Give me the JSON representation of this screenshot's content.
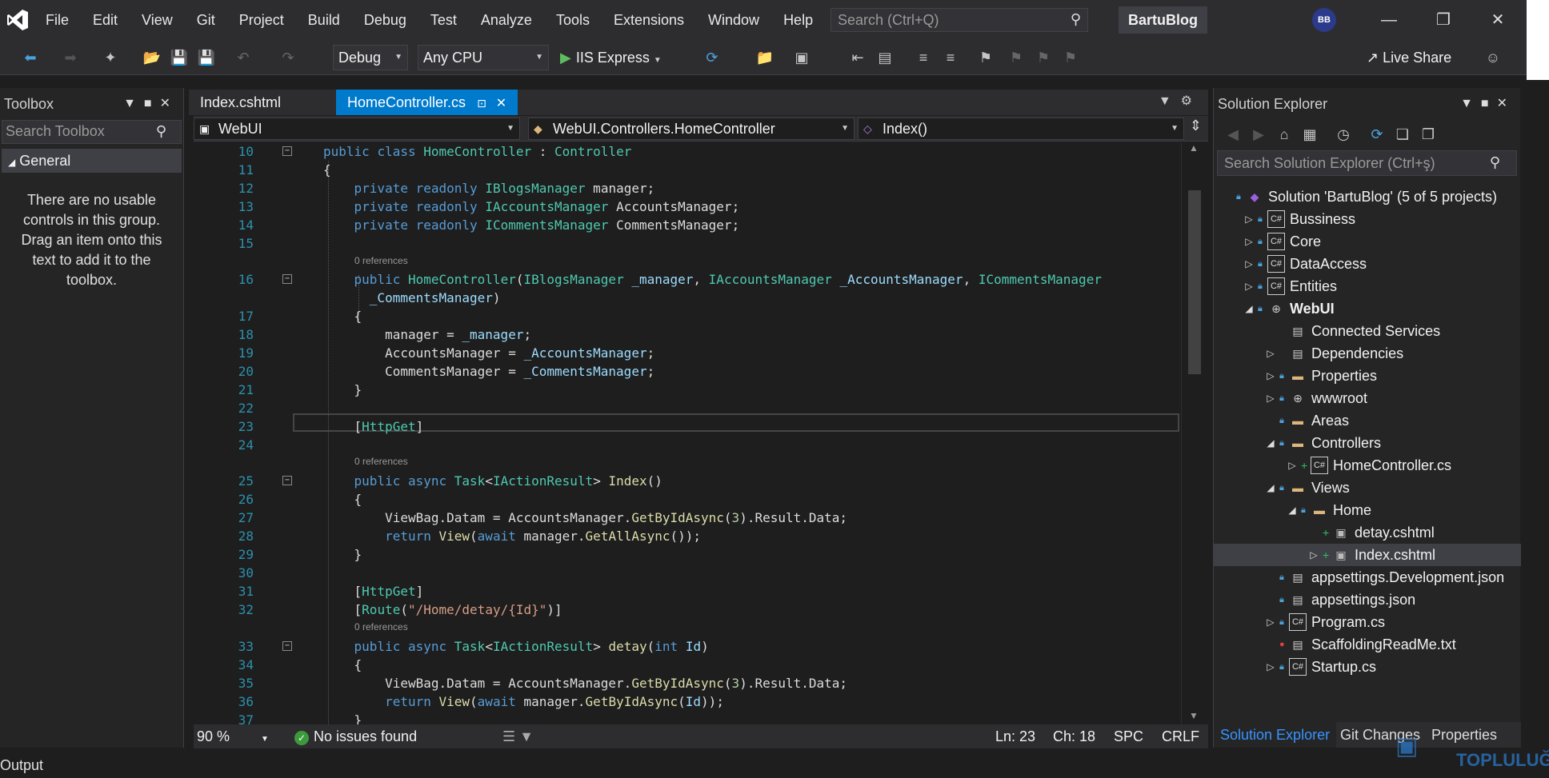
{
  "menu": {
    "items": [
      "File",
      "Edit",
      "View",
      "Git",
      "Project",
      "Build",
      "Debug",
      "Test",
      "Analyze",
      "Tools",
      "Extensions",
      "Window",
      "Help"
    ],
    "search_placeholder": "Search (Ctrl+Q)",
    "solution_name": "BartuBlog",
    "avatar": "BB"
  },
  "toolbar": {
    "config": "Debug",
    "platform": "Any CPU",
    "run_target": "IIS Express",
    "live_share": "Live Share"
  },
  "toolbox": {
    "title": "Toolbox",
    "search_placeholder": "Search Toolbox",
    "group": "General",
    "empty_message": "There are no usable controls in this group. Drag an item onto this text to add it to the toolbox."
  },
  "tabs": [
    {
      "label": "Index.cshtml",
      "active": false
    },
    {
      "label": "HomeController.cs",
      "active": true
    }
  ],
  "nav": {
    "project": "WebUI",
    "class": "WebUI.Controllers.HomeController",
    "member": "Index()"
  },
  "code": {
    "codelens_text": "0 references",
    "lines": [
      {
        "n": "10",
        "html": "<span class=\"kw\">public</span> <span class=\"kw\">class</span> <span class=\"ty\">HomeController</span> : <span class=\"ty\">Controller</span>"
      },
      {
        "n": "11",
        "html": "{"
      },
      {
        "n": "12",
        "html": "    <span class=\"kw\">private</span> <span class=\"kw\">readonly</span> <span class=\"ty\">IBlogsManager</span> manager;"
      },
      {
        "n": "13",
        "html": "    <span class=\"kw\">private</span> <span class=\"kw\">readonly</span> <span class=\"ty\">IAccountsManager</span> AccountsManager;"
      },
      {
        "n": "14",
        "html": "    <span class=\"kw\">private</span> <span class=\"kw\">readonly</span> <span class=\"ty\">ICommentsManager</span> CommentsManager;"
      },
      {
        "n": "15",
        "html": ""
      },
      {
        "n": "16",
        "html": "    <span class=\"kw\">public</span> <span class=\"ty\">HomeController</span>(<span class=\"ty\">IBlogsManager</span> <span class=\"param\">_manager</span>, <span class=\"ty\">IAccountsManager</span> <span class=\"param\">_AccountsManager</span>, <span class=\"ty\">ICommentsManager</span>"
      },
      {
        "n": "",
        "html": "      <span class=\"param\">_CommentsManager</span>)"
      },
      {
        "n": "17",
        "html": "    {"
      },
      {
        "n": "18",
        "html": "        manager = <span class=\"param\">_manager</span>;"
      },
      {
        "n": "19",
        "html": "        AccountsManager = <span class=\"param\">_AccountsManager</span>;"
      },
      {
        "n": "20",
        "html": "        CommentsManager = <span class=\"param\">_CommentsManager</span>;"
      },
      {
        "n": "21",
        "html": "    }"
      },
      {
        "n": "22",
        "html": ""
      },
      {
        "n": "23",
        "html": "    [<span class=\"attr\">HttpGet</span>]"
      },
      {
        "n": "24",
        "html": ""
      },
      {
        "n": "25",
        "html": "    <span class=\"kw\">public</span> <span class=\"kw\">async</span> <span class=\"ty\">Task</span>&lt;<span class=\"ty\">IActionResult</span>&gt; <span class=\"fn\">Index</span>()"
      },
      {
        "n": "26",
        "html": "    {"
      },
      {
        "n": "27",
        "html": "        ViewBag.Datam = AccountsManager.<span class=\"fn\">GetByIdAsync</span>(<span class=\"num\">3</span>).Result.Data;"
      },
      {
        "n": "28",
        "html": "        <span class=\"kw\">return</span> <span class=\"fn\">View</span>(<span class=\"kw\">await</span> manager.<span class=\"fn\">GetAllAsync</span>());"
      },
      {
        "n": "29",
        "html": "    }"
      },
      {
        "n": "30",
        "html": ""
      },
      {
        "n": "31",
        "html": "    [<span class=\"attr\">HttpGet</span>]"
      },
      {
        "n": "32",
        "html": "    [<span class=\"attr\">Route</span>(<span class=\"str\">\"/Home/detay/{Id}\"</span>)]"
      },
      {
        "n": "33",
        "html": "    <span class=\"kw\">public</span> <span class=\"kw\">async</span> <span class=\"ty\">Task</span>&lt;<span class=\"ty\">IActionResult</span>&gt; <span class=\"fn\">detay</span>(<span class=\"kw\">int</span> <span class=\"param\">Id</span>)"
      },
      {
        "n": "34",
        "html": "    {"
      },
      {
        "n": "35",
        "html": "        ViewBag.Datam = AccountsManager.<span class=\"fn\">GetByIdAsync</span>(<span class=\"num\">3</span>).Result.Data;"
      },
      {
        "n": "36",
        "html": "        <span class=\"kw\">return</span> <span class=\"fn\">View</span>(<span class=\"kw\">await</span> manager.<span class=\"fn\">GetByIdAsync</span>(<span class=\"param\">Id</span>));"
      },
      {
        "n": "37",
        "html": "    }"
      }
    ]
  },
  "editor_status": {
    "zoom": "90 %",
    "issues": "No issues found",
    "line": "Ln: 23",
    "col": "Ch: 18",
    "whitespace": "SPC",
    "eol": "CRLF"
  },
  "solution_explorer": {
    "title": "Solution Explorer",
    "search_placeholder": "Search Solution Explorer (Ctrl+ş)",
    "items": [
      {
        "label": "Solution 'BartuBlog' (5 of 5 projects)",
        "icon": "sln"
      },
      {
        "label": "Bussiness",
        "icon": "cs"
      },
      {
        "label": "Core",
        "icon": "cs"
      },
      {
        "label": "DataAccess",
        "icon": "cs"
      },
      {
        "label": "Entities",
        "icon": "cs"
      },
      {
        "label": "WebUI",
        "icon": "globe"
      },
      {
        "label": "Connected Services",
        "icon": "file"
      },
      {
        "label": "Dependencies",
        "icon": "file"
      },
      {
        "label": "Properties",
        "icon": "folder"
      },
      {
        "label": "wwwroot",
        "icon": "globe"
      },
      {
        "label": "Areas",
        "icon": "folder"
      },
      {
        "label": "Controllers",
        "icon": "folder"
      },
      {
        "label": "HomeController.cs",
        "icon": "cs"
      },
      {
        "label": "Views",
        "icon": "folder"
      },
      {
        "label": "Home",
        "icon": "folder"
      },
      {
        "label": "detay.cshtml",
        "icon": "cshtml"
      },
      {
        "label": "Index.cshtml",
        "icon": "cshtml"
      },
      {
        "label": "appsettings.Development.json",
        "icon": "file"
      },
      {
        "label": "appsettings.json",
        "icon": "file"
      },
      {
        "label": "Program.cs",
        "icon": "cs"
      },
      {
        "label": "ScaffoldingReadMe.txt",
        "icon": "file"
      },
      {
        "label": "Startup.cs",
        "icon": "cs"
      }
    ],
    "tabs": [
      "Solution Explorer",
      "Git Changes",
      "Properties"
    ]
  },
  "output": {
    "label": "Output"
  },
  "watermark": {
    "text": "TOPLULUĞU"
  }
}
